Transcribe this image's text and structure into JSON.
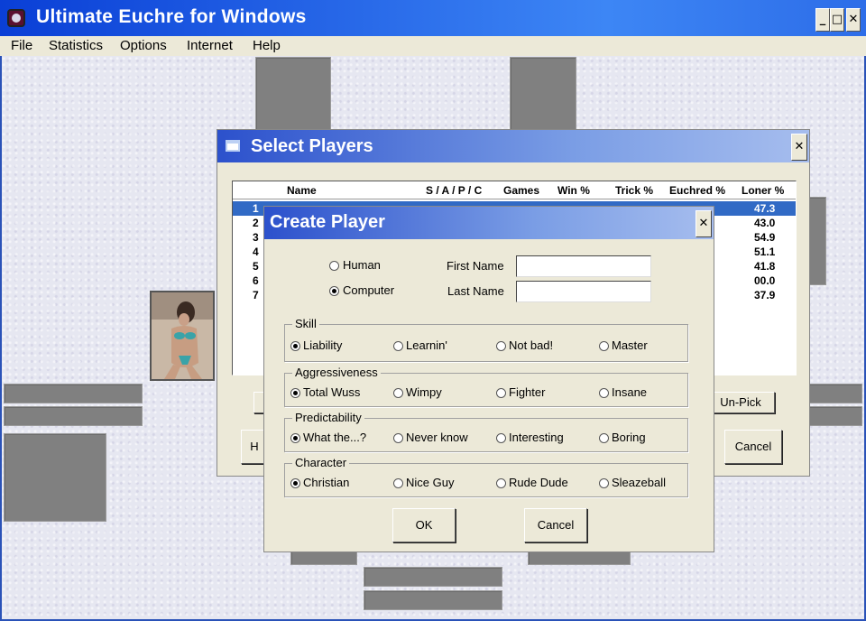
{
  "app": {
    "title": "Ultimate Euchre for Windows"
  },
  "menu": [
    "File",
    "Statistics",
    "Options",
    "Internet",
    "Help"
  ],
  "select_dialog": {
    "title": "Select Players",
    "columns": [
      "Name",
      "S / A / P / C",
      "Games",
      "Win %",
      "Trick %",
      "Euchred %",
      "Loner %"
    ],
    "rows": [
      {
        "num": "1",
        "loner": "47.3"
      },
      {
        "num": "2",
        "loner": "43.0"
      },
      {
        "num": "3",
        "loner": "54.9"
      },
      {
        "num": "4",
        "loner": "51.1"
      },
      {
        "num": "5",
        "loner": "41.8"
      },
      {
        "num": "6",
        "loner": "00.0"
      },
      {
        "num": "7",
        "loner": "37.9"
      }
    ],
    "unpick_label": "Un-Pick",
    "cancel_label": "Cancel",
    "partial_button_label": "H"
  },
  "create_dialog": {
    "title": "Create Player",
    "player_type": {
      "human": "Human",
      "computer": "Computer",
      "selected": "computer"
    },
    "first_name": {
      "label": "First Name",
      "value": ""
    },
    "last_name": {
      "label": "Last Name",
      "value": ""
    },
    "groups": [
      {
        "title": "Skill",
        "options": [
          "Liability",
          "Learnin'",
          "Not bad!",
          "Master"
        ],
        "selected": 0
      },
      {
        "title": "Aggressiveness",
        "options": [
          "Total Wuss",
          "Wimpy",
          "Fighter",
          "Insane"
        ],
        "selected": 0
      },
      {
        "title": "Predictability",
        "options": [
          "What the...?",
          "Never know",
          "Interesting",
          "Boring"
        ],
        "selected": 0
      },
      {
        "title": "Character",
        "options": [
          "Christian",
          "Nice Guy",
          "Rude Dude",
          "Sleazeball"
        ],
        "selected": 0
      }
    ],
    "ok_label": "OK",
    "cancel_label": "Cancel"
  },
  "colors": {
    "titlebar": "#0a3fd6",
    "dialog_face": "#ece9d8",
    "selection": "#316ac5",
    "table_felt": "#e6e7f1",
    "card_slot": "#808080"
  }
}
